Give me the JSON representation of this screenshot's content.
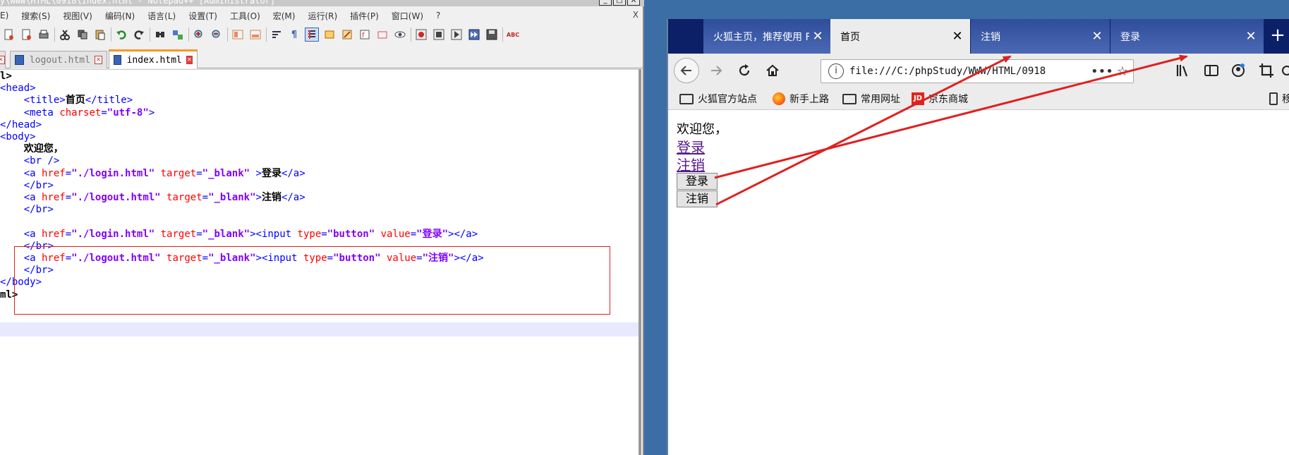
{
  "notepad": {
    "title": "y\\WWW\\HTML\\0918\\index.html - Notepad++ [Administrator]",
    "window_buttons": [
      "_",
      "□",
      "X"
    ],
    "menu": [
      "E)",
      "搜索(S)",
      "视图(V)",
      "编码(N)",
      "语言(L)",
      "设置(T)",
      "工具(O)",
      "宏(M)",
      "运行(R)",
      "插件(P)",
      "窗口(W)",
      "?"
    ],
    "menu_close": "X",
    "tabs": [
      {
        "label": "logout.html",
        "active": false
      },
      {
        "label": "index.html",
        "active": true
      }
    ],
    "tab_close": "✕",
    "code_lines": [
      "l>",
      "<head>",
      "    <title>首页</title>",
      "    <meta charset=\"utf-8\">",
      "</head>",
      "<body>",
      "    欢迎您，",
      "    <br />",
      "    <a href=\"./login.html\" target=\"_blank\" >登录</a>",
      "    </br>",
      "    <a href=\"./logout.html\" target=\"_blank\">注销</a>",
      "    </br>",
      "",
      "    <a href=\"./login.html\" target=\"_blank\"><input type=\"button\" value=\"登录\"></a>",
      "    </br>",
      "    <a href=\"./logout.html\" target=\"_blank\"><input type=\"button\" value=\"注销\"></a>",
      "    </br>",
      "</body>",
      "ml>"
    ]
  },
  "firefox": {
    "tabs": [
      {
        "label": "火狐主页，推荐使用 F",
        "selected": false
      },
      {
        "label": "首页",
        "selected": true
      },
      {
        "label": "注销",
        "selected": false
      },
      {
        "label": "登录",
        "selected": false
      }
    ],
    "tab_close": "✕",
    "new_tab": "+",
    "url": "file:///C:/phpStudy/WWW/HTML/0918",
    "url_more": "•••",
    "bookmarks": [
      "火狐官方站点",
      "新手上路",
      "常用网址",
      "京东商城"
    ],
    "bookmark_mobile": "移",
    "jd_mark": "JD",
    "page": {
      "welcome": "欢迎您，",
      "link_login": "登录",
      "link_logout": "注销",
      "button_login": "登录",
      "button_logout": "注销"
    }
  },
  "colors": {
    "annotation_red": "#e02020",
    "firefox_tabstrip": "#0c2068",
    "link_visited": "#551a8b"
  }
}
